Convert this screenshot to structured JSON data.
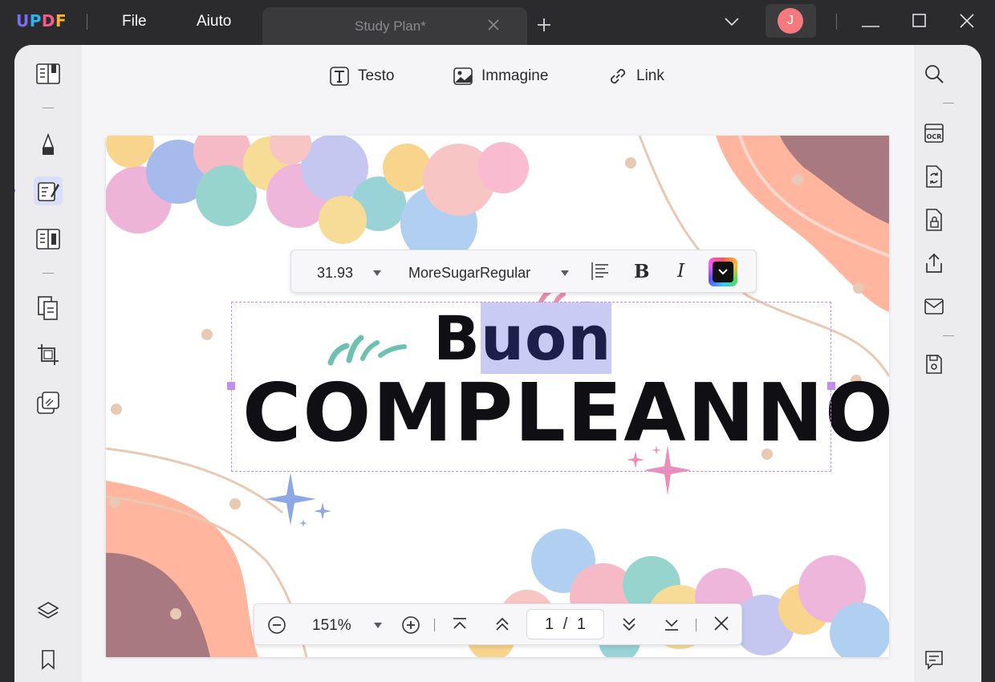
{
  "app": {
    "logo": "UPDF",
    "logo_colors": [
      "#7b6cf6",
      "#2bb3f3",
      "#f35b8c",
      "#f7b12e"
    ],
    "menu": [
      "File",
      "Aiuto"
    ],
    "tab_title": "Study Plan*",
    "avatar_initial": "J",
    "avatar_color": "#f47a80"
  },
  "toolbar": {
    "text_label": "Testo",
    "image_label": "Immagine",
    "link_label": "Link"
  },
  "format_bar": {
    "font_size": "31.93",
    "font_family": "MoreSugarRegular",
    "bold_label": "B",
    "italic_label": "I"
  },
  "document": {
    "line1_prefix": "B",
    "line1_selected": "uon",
    "line2": "COMPLEANNO"
  },
  "zoom_bar": {
    "zoom": "151%",
    "current_page": "1",
    "page_separator": "/",
    "total_pages": "1"
  },
  "colors": {
    "accent": "#8e6ef5",
    "selection": "#c9cbf4",
    "textbox_border": "#c58cf0",
    "peach": "#ffb59e"
  }
}
